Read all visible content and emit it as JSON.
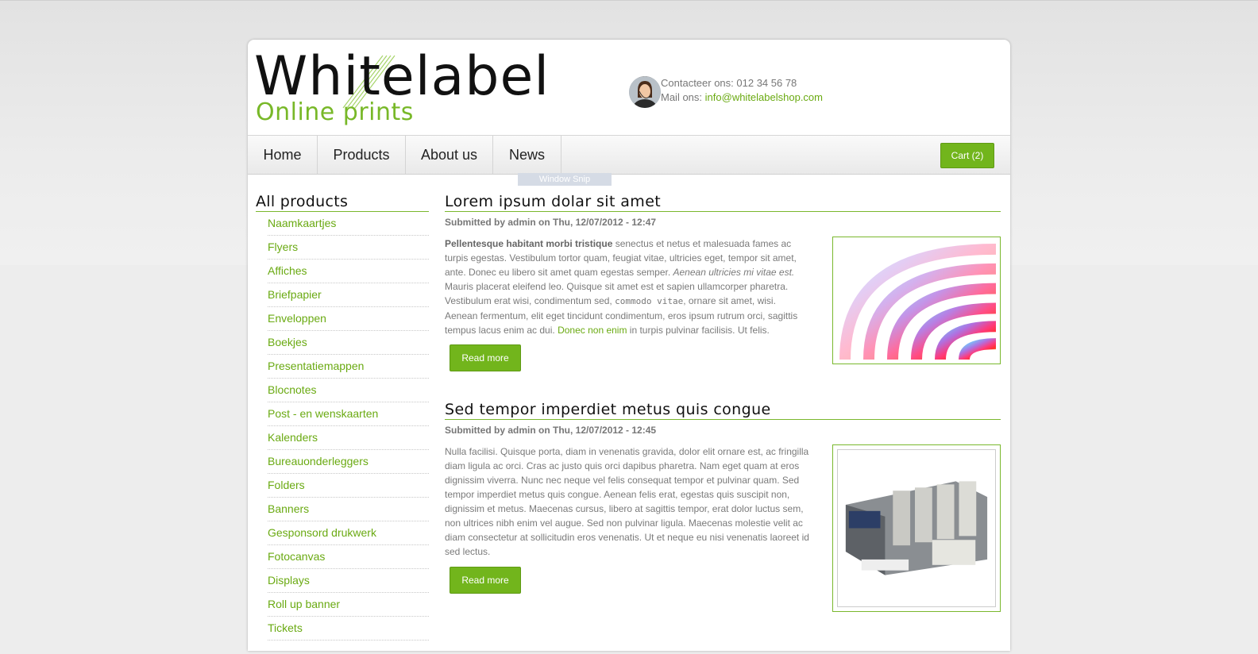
{
  "header": {
    "logo_main": "Whitelabel",
    "logo_sub": "Online prints",
    "contact_label": "Contacteer ons: 012 34 56 78",
    "mail_label": "Mail ons:",
    "mail_value": "info@whitelabelshop.com"
  },
  "nav": {
    "items": [
      {
        "label": "Home"
      },
      {
        "label": "Products"
      },
      {
        "label": "About us"
      },
      {
        "label": "News"
      }
    ],
    "cart_label": "Cart (2)",
    "snip_label": "Window Snip"
  },
  "sidebar": {
    "title": "All products",
    "items": [
      "Naamkaartjes",
      "Flyers",
      "Affiches",
      "Briefpapier",
      "Enveloppen",
      "Boekjes",
      "Presentatiemappen",
      "Blocnotes",
      "Post - en wenskaarten",
      "Kalenders",
      "Bureauonderleggers",
      "Folders",
      "Banners",
      "Gesponsord drukwerk",
      "Fotocanvas",
      "Displays",
      "Roll up banner",
      "Tickets"
    ]
  },
  "articles": [
    {
      "title": "Lorem ipsum dolar sit amet",
      "meta": "Submitted by admin on Thu, 12/07/2012 - 12:47",
      "body": {
        "lead_bold": "Pellentesque habitant morbi tristique",
        "text1": " senectus et netus et malesuada fames ac turpis egestas. Vestibulum tortor quam, feugiat vitae, ultricies eget, tempor sit amet, ante. Donec eu libero sit amet quam egestas semper. ",
        "italic": "Aenean ultricies mi vitae est.",
        "text2": " Mauris placerat eleifend leo. Quisque sit amet est et sapien ullamcorper pharetra. Vestibulum erat wisi, condimentum sed, ",
        "code": "commodo vitae",
        "text3": ", ornare sit amet, wisi. Aenean fermentum, elit eget tincidunt condimentum, eros ipsum rutrum orci, sagittis tempus lacus enim ac dui. ",
        "link": "Donec non enim",
        "text4": " in turpis pulvinar facilisis. Ut felis."
      },
      "read_more": "Read more",
      "image": "color-swatch-fan"
    },
    {
      "title": "Sed tempor imperdiet metus quis congue",
      "meta": "Submitted by admin on Thu, 12/07/2012 - 12:45",
      "body_text": "Nulla facilisi. Quisque porta, diam in venenatis gravida, dolor elit ornare est, ac fringilla diam ligula ac orci. Cras ac justo quis orci dapibus pharetra. Nam eget quam at eros dignissim viverra. Nunc nec neque vel felis consequat tempor et pulvinar quam. Sed tempor imperdiet metus quis congue. Aenean felis erat, egestas quis suscipit non, dignissim et metus. Maecenas cursus, libero at sagittis tempor, erat dolor luctus sem, non ultrices nibh enim vel augue. Sed non pulvinar ligula. Maecenas molestie velit ac diam consectetur at sollicitudin eros venenatis. Ut et neque eu nisi venenatis laoreet id sed lectus.",
      "read_more": "Read more",
      "image": "printing-press"
    }
  ],
  "colors": {
    "accent": "#72b51c",
    "link": "#6aaa12",
    "text": "#7a7a7a"
  }
}
